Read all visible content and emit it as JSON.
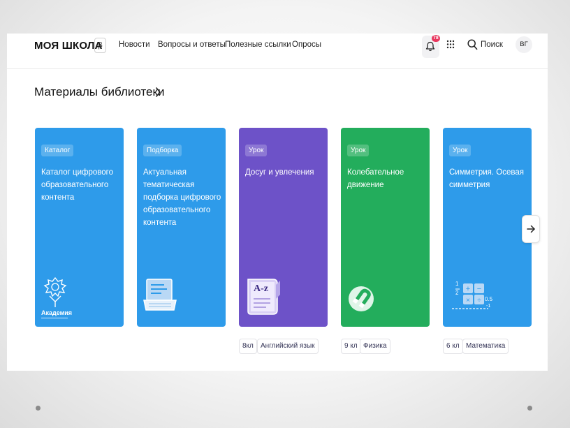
{
  "header": {
    "logo": "МОЯ ШКОЛА",
    "beta": "β",
    "nav": [
      "Новости",
      "Вопросы и ответы",
      "Полезные ссылки",
      "Опросы"
    ],
    "notifications_count": "78",
    "search_label": "Поиск",
    "avatar_initials": "ВГ"
  },
  "section": {
    "title": "Материалы библиотеки"
  },
  "cards": [
    {
      "tag": "Каталог",
      "title": "Каталог цифрового образовательного контента",
      "color": "#2e9bea",
      "icon": "academy-emblem-icon"
    },
    {
      "tag": "Подборка",
      "title": "Актуальная тематическая подборка цифрового образовательного контента",
      "color": "#2e9bea",
      "icon": "laptop-icon"
    },
    {
      "tag": "Урок",
      "title": "Досуг и увлечения",
      "color": "#6d52c8",
      "icon": "dictionary-icon"
    },
    {
      "tag": "Урок",
      "title": "Колебательное движение",
      "color": "#23ad5c",
      "icon": "magnet-icon"
    },
    {
      "tag": "Урок",
      "title": "Симметрия. Осевая симметрия",
      "color": "#2e9bea",
      "icon": "math-symbols-icon"
    }
  ],
  "chips": {
    "card3": [
      "8кл",
      "Английский язык"
    ],
    "card4": [
      "9 кл",
      "Физика"
    ],
    "card5": [
      "6 кл",
      "Математика"
    ]
  },
  "academy_text": "Академия",
  "math_values": {
    "fraction_top": "1",
    "fraction_bottom": "2",
    "decimal": "0.5",
    "negative": "-1"
  },
  "dictionary_text": "A-z"
}
